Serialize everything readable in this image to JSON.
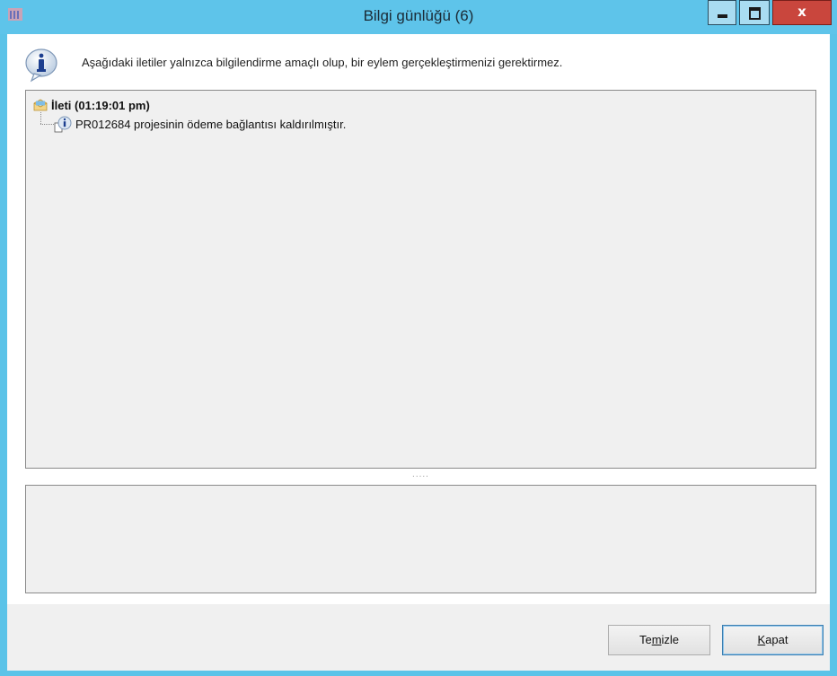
{
  "window": {
    "title": "Bilgi günlüğü (6)",
    "controls": {
      "minimize_icon": "minimize-icon",
      "maximize_icon": "maximize-icon",
      "close_glyph": "x"
    }
  },
  "info_bar": {
    "icon": "info-balloon-icon",
    "text": "Aşağıdaki iletiler yalnızca bilgilendirme amaçlı olup, bir eylem gerçekleştirmenizi gerektirmez."
  },
  "log_tree": {
    "root": {
      "icon": "message-envelope-icon",
      "label": "İleti (01:19:01 pm)"
    },
    "children": [
      {
        "icon": "info-message-icon",
        "label": "PR012684 projesinin ödeme bağlantısı kaldırılmıştır."
      }
    ]
  },
  "splitter": {
    "grip": "....."
  },
  "buttons": {
    "clear": {
      "label_pre": "Te",
      "label_mnemonic": "m",
      "label_post": "izle"
    },
    "close": {
      "label_mnemonic": "K",
      "label_post": "apat"
    }
  },
  "colors": {
    "titlebar": "#5ec4ea",
    "close_button": "#c9463d",
    "panel": "#f0f0f0"
  }
}
